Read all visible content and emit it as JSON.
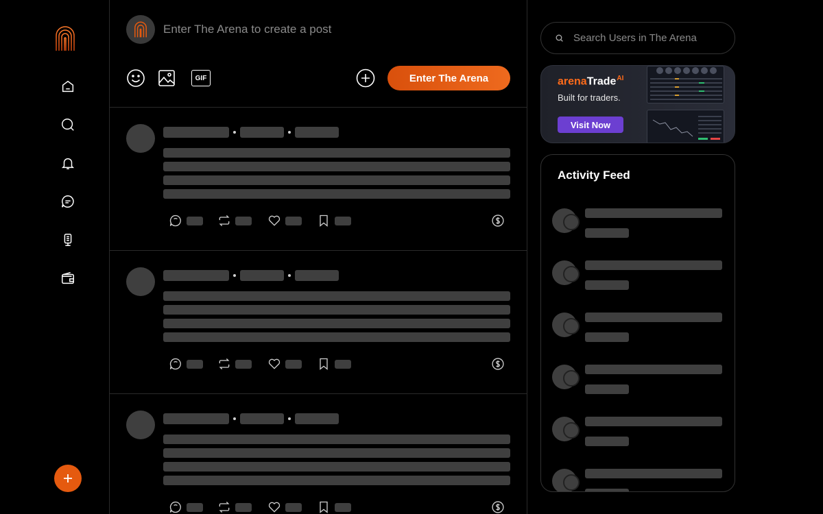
{
  "brand": {
    "accent": "#e55a0f",
    "accent_end": "#f06a1f",
    "promo_button": "#6c3fd1"
  },
  "nav": {
    "items": [
      {
        "name": "home",
        "icon": "home-icon"
      },
      {
        "name": "search",
        "icon": "search-icon"
      },
      {
        "name": "notifications",
        "icon": "bell-icon"
      },
      {
        "name": "messages",
        "icon": "chat-icon"
      },
      {
        "name": "stage",
        "icon": "microphone-icon"
      },
      {
        "name": "wallet",
        "icon": "wallet-icon"
      }
    ],
    "fab_icon": "plus-icon"
  },
  "composer": {
    "placeholder": "Enter The Arena to create a post",
    "tools": [
      "emoji-icon",
      "image-icon",
      "gif-icon"
    ],
    "gif_label": "GIF",
    "cta_label": "Enter The Arena"
  },
  "posts_loading": 3,
  "search": {
    "placeholder": "Search Users in The Arena"
  },
  "promo": {
    "brand_a": "arena",
    "brand_b": "Trade",
    "brand_ai": "AI",
    "subtitle": "Built for traders.",
    "button_label": "Visit Now"
  },
  "activity": {
    "title": "Activity Feed",
    "loading_rows": 6
  }
}
